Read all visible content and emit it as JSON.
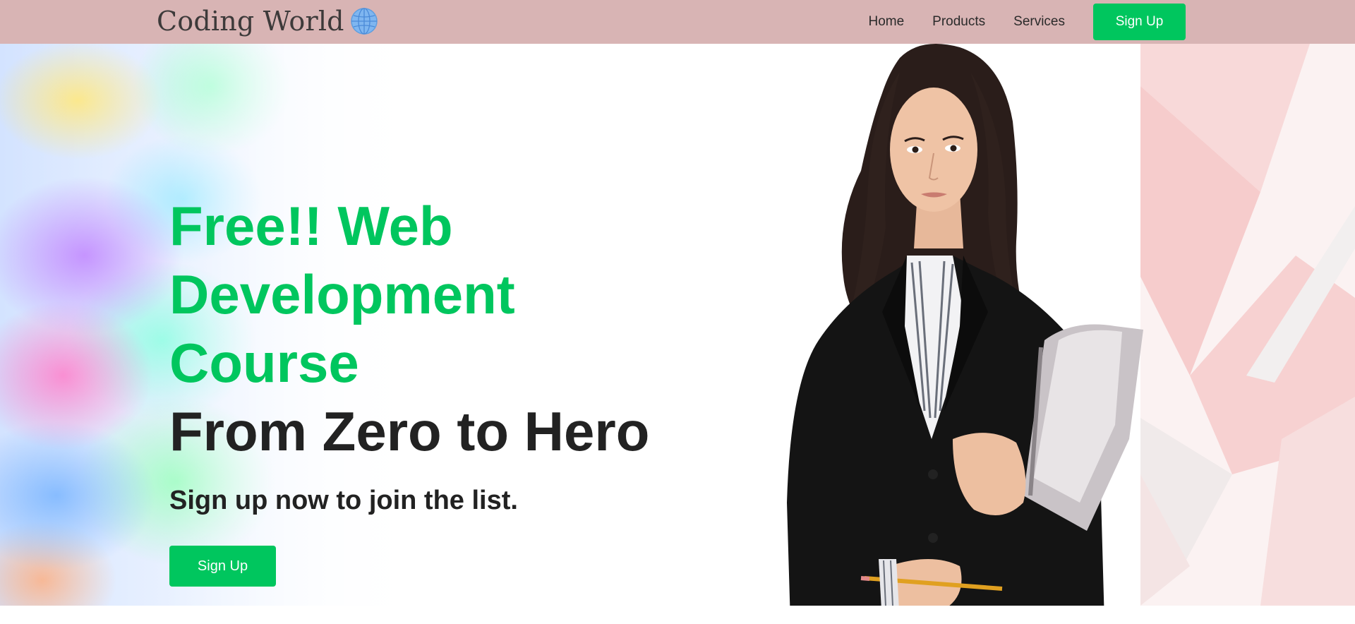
{
  "navbar": {
    "brand": "Coding World",
    "brand_icon": "globe-icon",
    "links": [
      "Home",
      "Products",
      "Services"
    ],
    "signup_label": "Sign Up",
    "background": "#d8b4b4",
    "accent": "#00c65e"
  },
  "hero": {
    "headline_green": "Free!! Web Development Course",
    "headline_dark": "From Zero to Hero",
    "subtitle": "Sign up now to join the list.",
    "signup_label": "Sign Up",
    "green_color": "#00c65e",
    "dark_color": "#222222"
  }
}
